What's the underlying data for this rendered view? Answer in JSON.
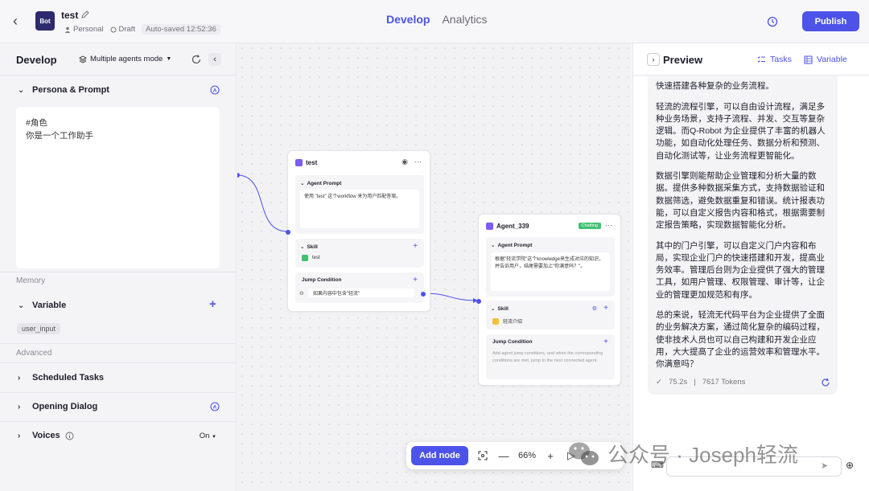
{
  "topbar": {
    "bot_avatar_text": "Bot",
    "bot_name": "test",
    "visibility": "Personal",
    "status": "Draft",
    "autosave": "Auto-saved 12:52:36",
    "tabs": [
      {
        "label": "Develop",
        "active": true
      },
      {
        "label": "Analytics",
        "active": false
      }
    ],
    "publish_label": "Publish"
  },
  "left": {
    "title": "Develop",
    "mode": "Multiple agents mode",
    "persona_label": "Persona & Prompt",
    "prompt_text_line1": "#角色",
    "prompt_text_line2": "你是一个工作助手",
    "memory_label": "Memory",
    "variable_label": "Variable",
    "variable_chip": "user_input",
    "advanced_label": "Advanced",
    "scheduled_label": "Scheduled Tasks",
    "opening_label": "Opening Dialog",
    "voices_label": "Voices",
    "voices_value": "On"
  },
  "canvas": {
    "node1": {
      "title": "test",
      "agent_prompt_label": "Agent Prompt",
      "agent_prompt_text": "使用 \"test\" 这个workflow 来为用户匹配答案。",
      "skill_label": "Skill",
      "skill_item": "test",
      "jump_label": "Jump Condition",
      "jump_item": "如果内容中包含\"轻流\""
    },
    "node2": {
      "title": "Agent_339",
      "badge": "Chatting",
      "agent_prompt_label": "Agent Prompt",
      "agent_prompt_text": "根据\"轻流学院\"这个knowledge来生成对应的知识，并告诉用户，结尾需要加上\"你满意吗？\"。",
      "skill_label": "Skill",
      "skill_item": "轻流介绍",
      "jump_label": "Jump Condition",
      "jump_desc": "Add agent jump conditions, and when the corresponding conditions are met, jump to the next connected agent."
    },
    "toolbar": {
      "add_node_label": "Add node",
      "zoom": "66%"
    }
  },
  "preview": {
    "title": "Preview",
    "tasks_label": "Tasks",
    "variable_label": "Variable",
    "message_paragraphs": [
      "快速搭建各种复杂的业务流程。",
      "轻流的流程引擎，可以自由设计流程，满足多种业务场景，支持子流程、并发、交互等复杂逻辑。而Q-Robot 为企业提供了丰富的机器人功能，如自动化处理任务、数据分析和预测、自动化测试等，让业务流程更智能化。",
      "数据引擎则能帮助企业管理和分析大量的数据。提供多种数据采集方式，支持数据验证和数据筛选，避免数据重复和错误。统计报表功能，可以自定义报告内容和格式，根据需要制定报告策略，实现数据智能化分析。",
      "其中的门户引擎，可以自定义门户内容和布局，实现企业门户的快速搭建和开发，提高业务效率。管理后台则为企业提供了强大的管理工具，如用户管理、权限管理、审计等，让企业的管理更加规范和有序。",
      "总的来说，轻流无代码平台为企业提供了全面的业务解决方案，通过简化复杂的编码过程，使非技术人员也可以自己构建和开发企业应用，大大提高了企业的运营效率和管理水平。你满意吗？"
    ],
    "elapsed": "75.2s",
    "tokens": "7617 Tokens"
  },
  "watermark": {
    "text": "公众号 · Joseph轻流"
  },
  "colors": {
    "accent": "#4d53e8",
    "bot_avatar": "#2d2a6e",
    "chatting": "#3ec26f",
    "node_icon": "#7c5cf2"
  }
}
